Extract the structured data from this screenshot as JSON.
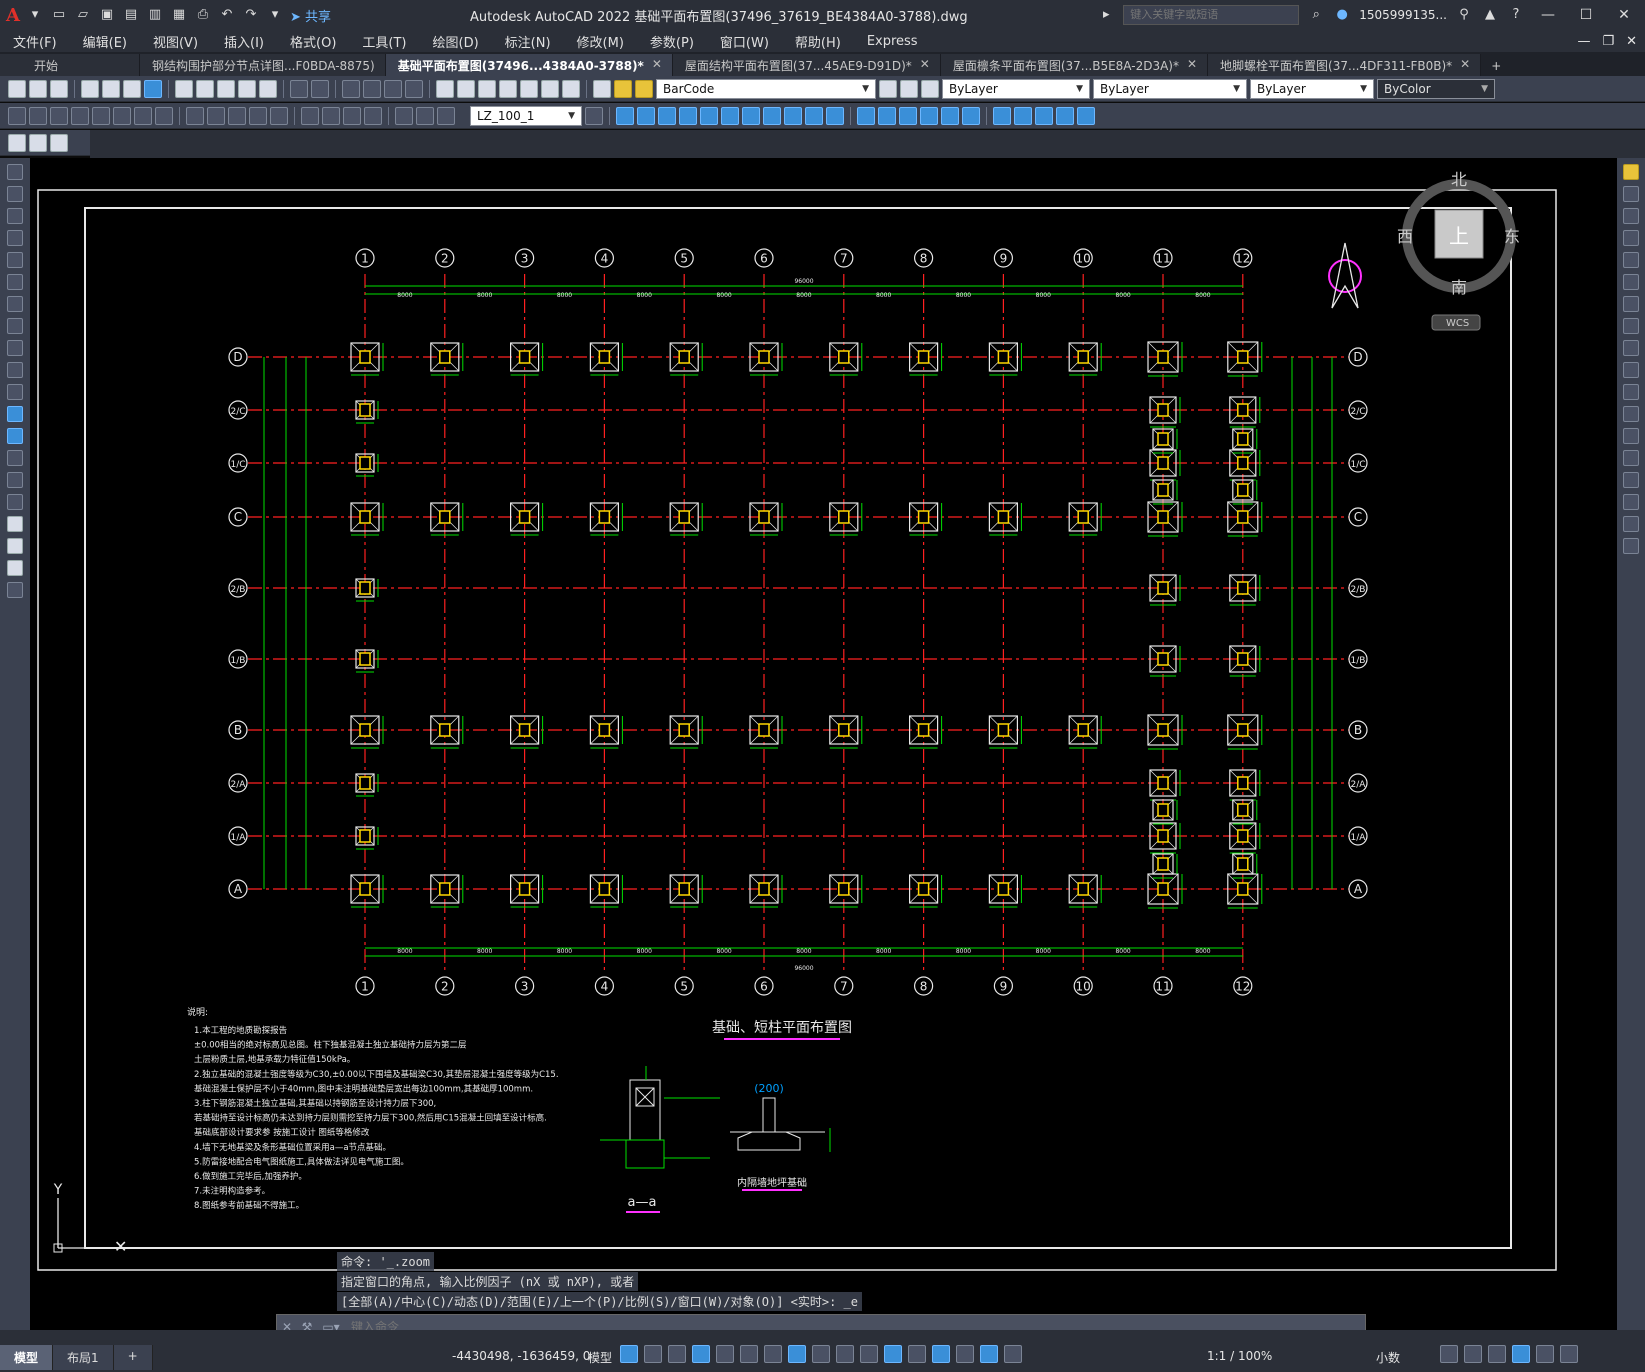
{
  "app": {
    "title": "Autodesk AutoCAD 2022    基础平面布置图(37496_37619_BE4384A0-3788).dwg",
    "share_label": "共享",
    "search_placeholder": "键入关键字或短语",
    "user": "1505999135...",
    "logo": "A"
  },
  "menu": [
    "文件(F)",
    "编辑(E)",
    "视图(V)",
    "插入(I)",
    "格式(O)",
    "工具(T)",
    "绘图(D)",
    "标注(N)",
    "修改(M)",
    "参数(P)",
    "窗口(W)",
    "帮助(H)",
    "Express"
  ],
  "tabs": [
    {
      "label": "开始",
      "active": false,
      "closable": false
    },
    {
      "label": "钢结构围护部分节点详图...F0BDA-8875)",
      "active": false,
      "closable": false
    },
    {
      "label": "基础平面布置图(37496...4384A0-3788)*",
      "active": true,
      "closable": true
    },
    {
      "label": "屋面结构平面布置图(37...45AE9-D91D)*",
      "active": false,
      "closable": true
    },
    {
      "label": "屋面檩条平面布置图(37...B5E8A-2D3A)*",
      "active": false,
      "closable": true
    },
    {
      "label": "地脚螺栓平面布置图(37...4DF311-FB0B)*",
      "active": false,
      "closable": true
    }
  ],
  "toolbar": {
    "layer": "BarCode",
    "color": "ByLayer",
    "linetype": "ByLayer",
    "lineweight": "ByLayer",
    "plotstyle": "ByColor",
    "dimstyle": "LZ_100_1"
  },
  "viewcube": {
    "north": "北",
    "south": "南",
    "east": "东",
    "west": "西",
    "top": "上",
    "wcs": "WCS"
  },
  "drawing": {
    "columns": [
      "1",
      "2",
      "3",
      "4",
      "5",
      "6",
      "7",
      "8",
      "9",
      "10",
      "11",
      "12"
    ],
    "rows": [
      "D",
      "2/C",
      "1/C",
      "C",
      "2/B",
      "1/B",
      "B",
      "2/A",
      "1/A",
      "A"
    ],
    "top_total": "96000",
    "bay": "8000",
    "title": "基础、短柱平面布置图",
    "section_label": "a—a",
    "detail_label": "内隔墙地坪基础",
    "detail_dim": "(200)",
    "axis_y": "Y"
  },
  "notes": {
    "heading": "说明:",
    "lines": [
      "1.本工程的地质勘探报告",
      "  ±0.00相当的绝对标高见总图。柱下独基混凝土独立基础持力层为第二层",
      "  土层粉质土层,地基承载力特征值150kPa。",
      "2.独立基础的混凝土强度等级为C30,±0.00以下围墙及基础梁C30,其垫层混凝土强度等级为C15.",
      "  基础混凝土保护层不小于40mm,图中未注明基础垫层宽出每边100mm,其基础厚100mm.",
      "3.柱下钢筋混凝土独立基础,其基础以持钢筋至设计持力层下300,",
      "  若基础持至设计标高仍未达到持力层则需挖至持力层下300,然后用C15混凝土回填至设计标高.",
      "  基础底部设计要求参 按施工设计 图纸等格修改",
      "4.墙下无地基梁及条形基础位置采用a—a节点基础。",
      "5.防雷接地配合电气图纸施工,具体做法详见电气施工图。",
      "6.做到施工完毕后,加强养护。",
      "7.未注明构造参考。",
      "8.图纸参考前基础不得施工。"
    ]
  },
  "command": {
    "history": [
      "命令: '_.zoom",
      "指定窗口的角点, 输入比例因子 (nX 或 nXP), 或者",
      "[全部(A)/中心(C)/动态(D)/范围(E)/上一个(P)/比例(S)/窗口(W)/对象(O)] <实时>: _e"
    ],
    "placeholder": "键入命令"
  },
  "status": {
    "layout_tabs": [
      "模型",
      "布局1"
    ],
    "coords": "-4430498, -1636459, 0",
    "space": "模型",
    "scale": "1:1 / 100%",
    "units": "小数"
  },
  "colors": {
    "accent": "#3a8fd8",
    "grid_red": "#ff2020",
    "dim_green": "#00e000",
    "footing_white": "#e8e8e8",
    "column_yellow": "#ffd800",
    "magenta": "#ff30ff"
  }
}
